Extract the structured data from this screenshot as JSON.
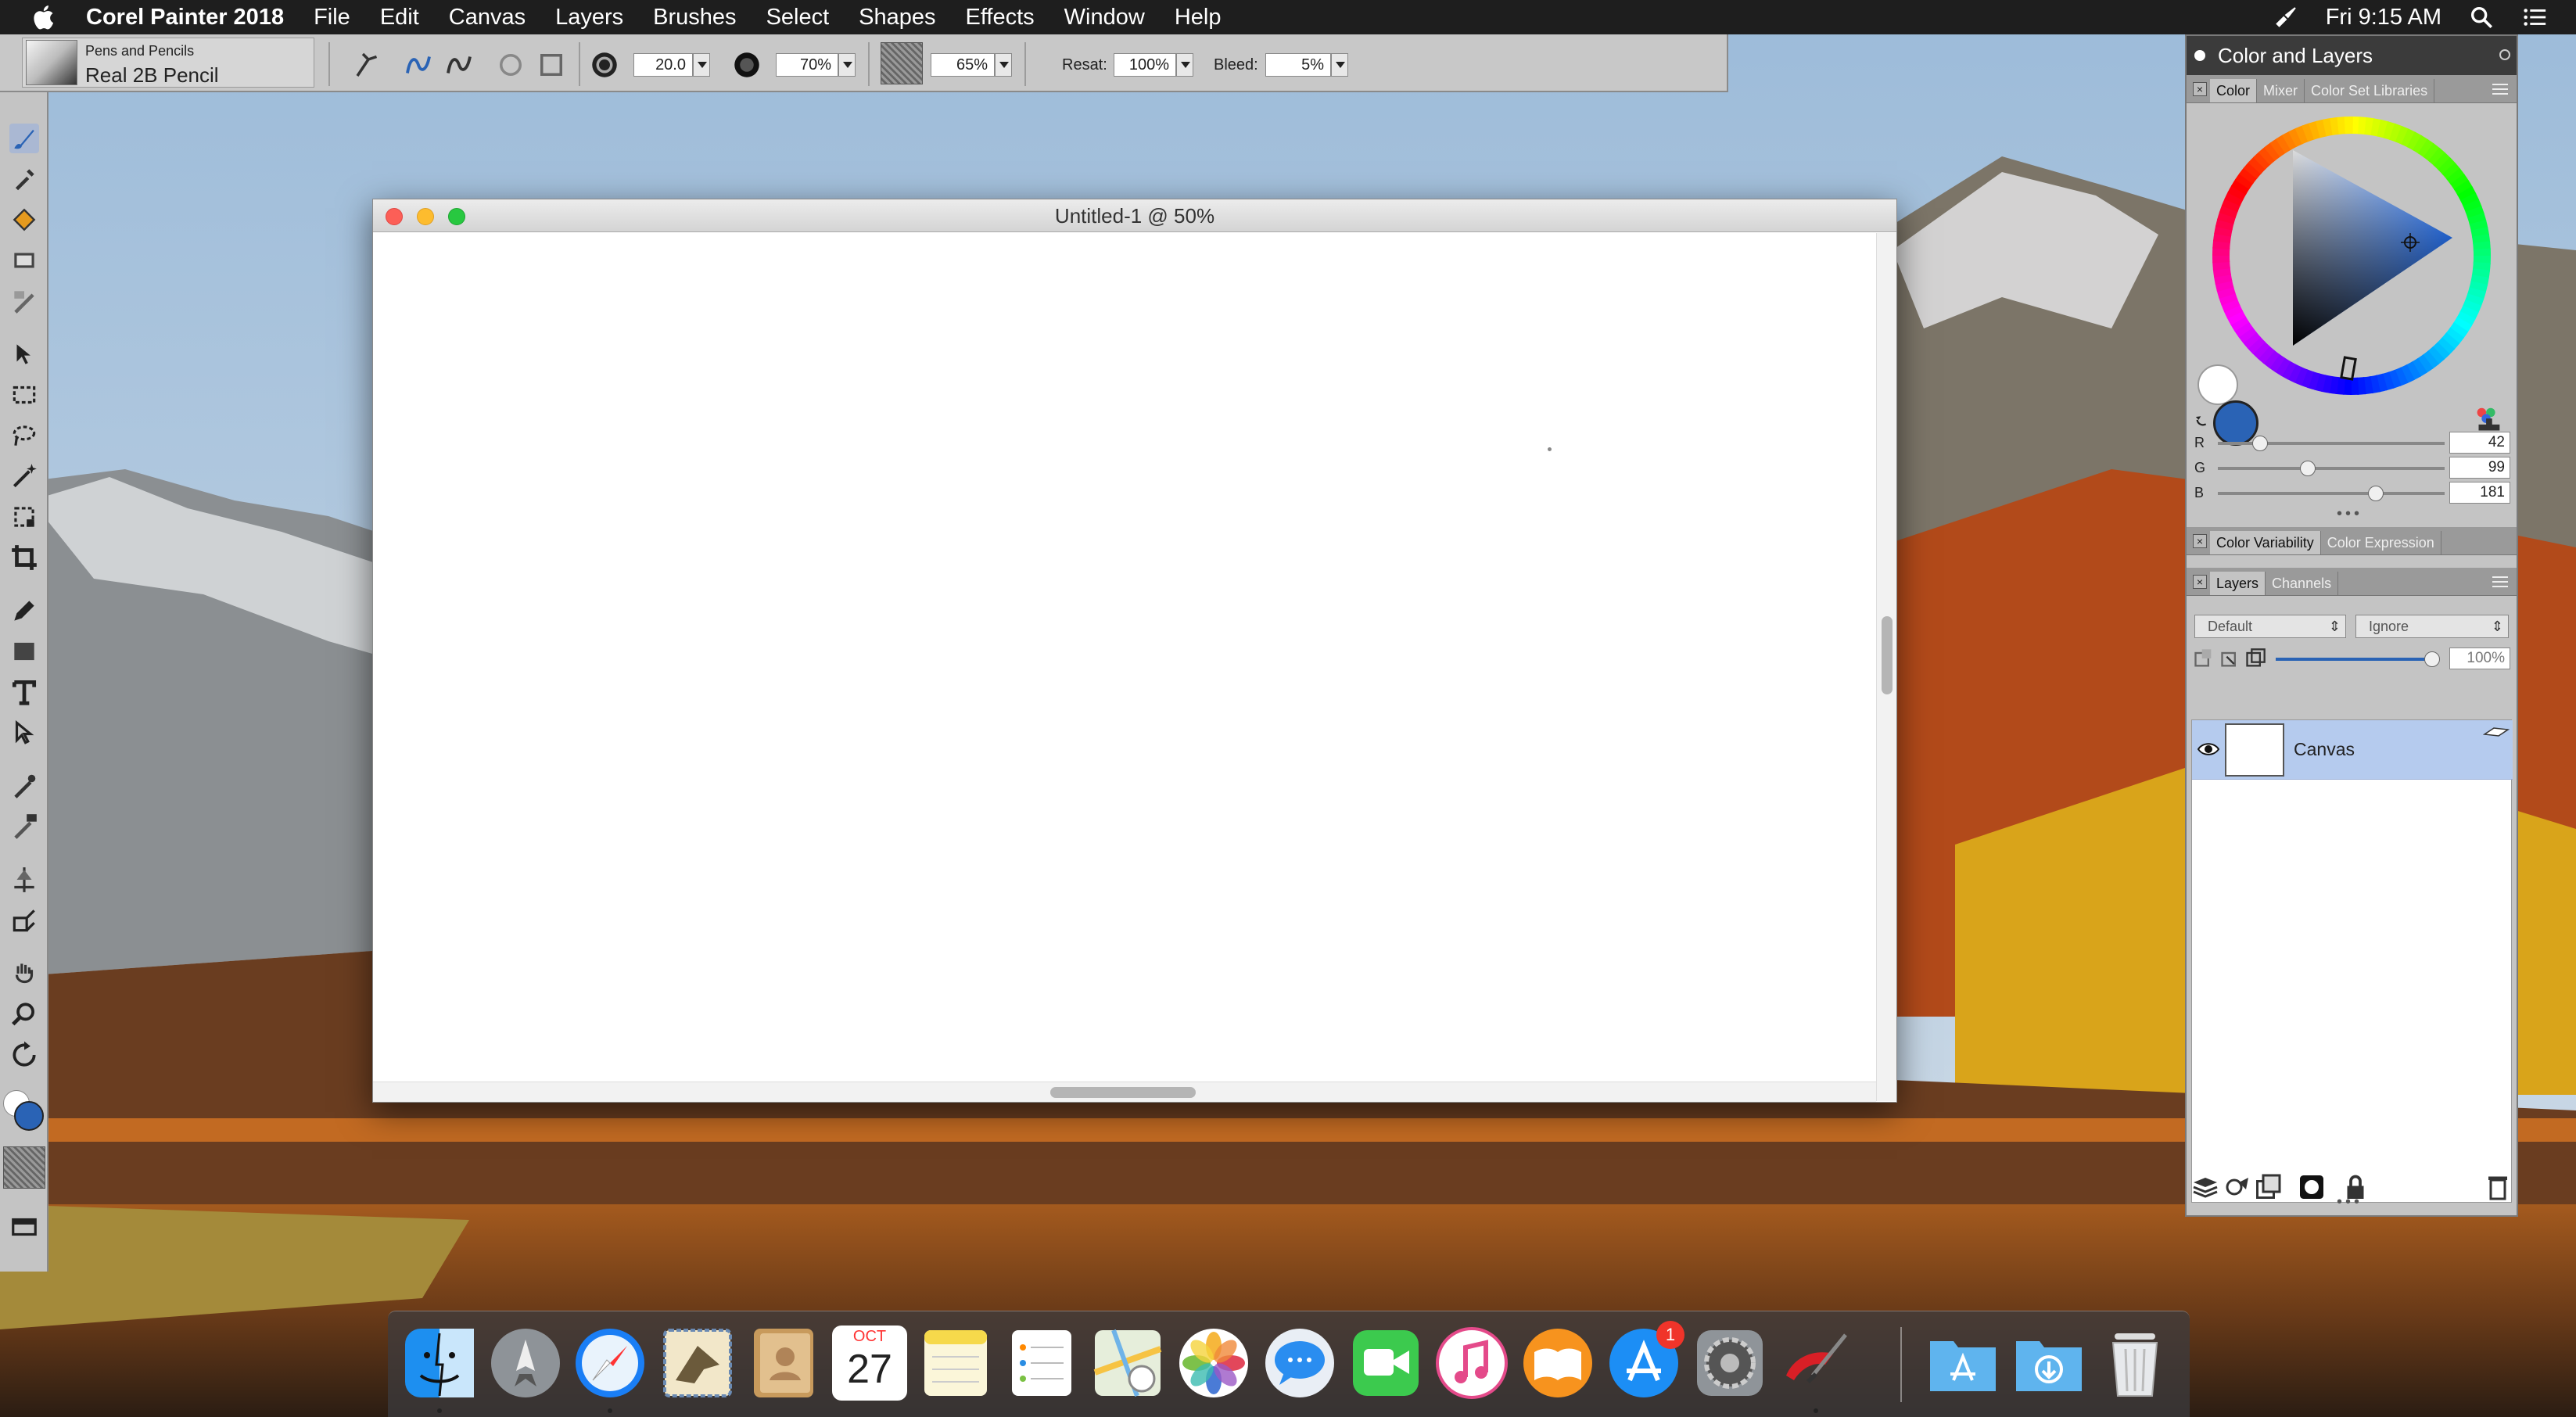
{
  "menubar": {
    "app_name": "Corel Painter 2018",
    "items": [
      "File",
      "Edit",
      "Canvas",
      "Layers",
      "Brushes",
      "Select",
      "Shapes",
      "Effects",
      "Window",
      "Help"
    ],
    "clock": "Fri 9:15 AM",
    "icons": [
      "apple-logo",
      "brush-status-icon",
      "spotlight-search-icon",
      "notification-center-icon"
    ]
  },
  "propbar": {
    "brush_category": "Pens and Pencils",
    "brush_variant": "Real 2B Pencil",
    "size_value": "20.0",
    "opacity_value": "70%",
    "grain_value": "65%",
    "resat_label": "Resat:",
    "resat_value": "100%",
    "bleed_label": "Bleed:",
    "bleed_value": "5%"
  },
  "toolbox": {
    "tools": [
      "brush-tool",
      "dropper-tool",
      "paint-bucket-tool",
      "eraser-tool",
      "blender-tool",
      "layer-adjuster-tool",
      "rectangular-selection-tool",
      "lasso-tool",
      "magic-wand-tool",
      "transform-tool",
      "crop-tool",
      "pen-tool",
      "rectangle-shape-tool",
      "text-tool",
      "shape-selection-tool",
      "cloner-tool",
      "rubber-stamp-tool",
      "dodge-tool",
      "perspective-guides-tool",
      "grabber-tool",
      "magnifier-tool",
      "rotate-page-tool"
    ],
    "main_color": "#2a63b5",
    "additional_color": "#ffffff"
  },
  "document": {
    "title": "Untitled-1 @ 50%"
  },
  "panel": {
    "title": "Color and Layers",
    "color_tabs": [
      "Color",
      "Mixer",
      "Color Set Libraries"
    ],
    "rgb": {
      "r_label": "R",
      "r_value": "42",
      "g_label": "G",
      "g_value": "99",
      "b_label": "B",
      "b_value": "181"
    },
    "current_color": "#2a63b5",
    "variability_tabs": [
      "Color Variability",
      "Color Expression"
    ],
    "layer_tabs": [
      "Layers",
      "Channels"
    ],
    "composite_method": "Default",
    "composite_depth": "Ignore",
    "layer_opacity": "100%",
    "layers": [
      {
        "name": "Canvas",
        "visible": true,
        "selected": true
      }
    ]
  },
  "dock": {
    "apps": [
      "Finder",
      "Launchpad",
      "Safari",
      "Mail",
      "Contacts",
      "Calendar",
      "Notes",
      "Reminders",
      "Maps",
      "Photos",
      "Messages",
      "FaceTime",
      "iTunes",
      "iBooks",
      "App Store",
      "System Preferences",
      "Corel Painter 2018"
    ],
    "calendar_month": "OCT",
    "calendar_day": "27",
    "app_store_badge": "1",
    "folders": [
      "Applications",
      "Downloads"
    ],
    "trash": "Trash"
  }
}
